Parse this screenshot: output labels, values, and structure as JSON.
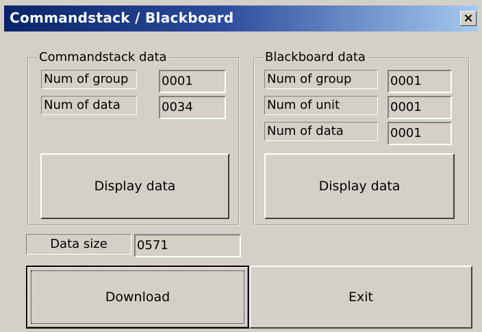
{
  "window": {
    "title": "Commandstack / Blackboard",
    "close_glyph": "×"
  },
  "commandstack": {
    "legend": "Commandstack data",
    "fields": [
      {
        "label": "Num of group",
        "value": "0001"
      },
      {
        "label": "Num of data",
        "value": "0034"
      }
    ],
    "display_button": "Display data"
  },
  "blackboard": {
    "legend": "Blackboard data",
    "fields": [
      {
        "label": "Num of group",
        "value": "0001"
      },
      {
        "label": "Num of unit",
        "value": "0001"
      },
      {
        "label": "Num of data",
        "value": "0001"
      }
    ],
    "display_button": "Display data"
  },
  "data_size": {
    "label": "Data size",
    "value": "0571"
  },
  "buttons": {
    "download": "Download",
    "exit": "Exit"
  },
  "icons": {
    "close": "close-icon"
  }
}
